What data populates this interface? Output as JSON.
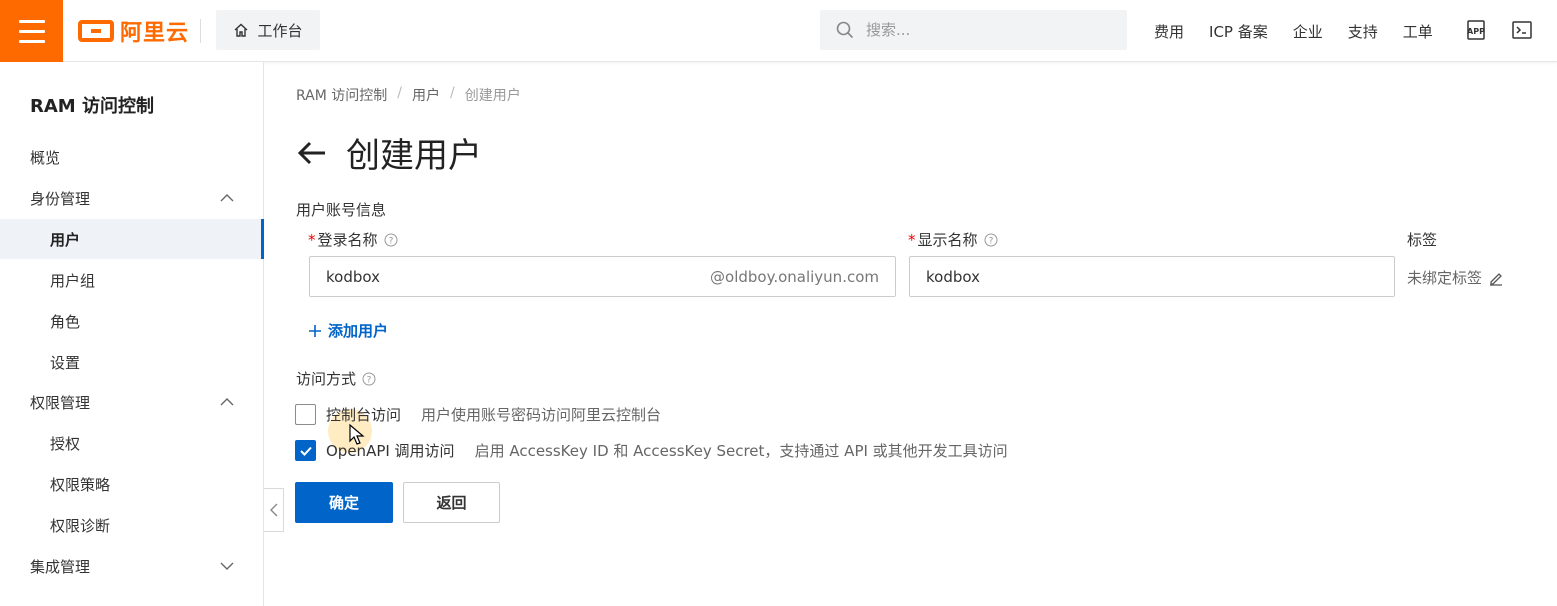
{
  "topbar": {
    "brand": "阿里云",
    "workbench_label": "工作台",
    "search_placeholder": "搜索...",
    "nav": [
      "费用",
      "ICP 备案",
      "企业",
      "支持",
      "工单"
    ],
    "icons": [
      "app-icon",
      "terminal-icon"
    ]
  },
  "sidebar": {
    "title": "RAM 访问控制",
    "items": [
      {
        "label": "概览",
        "level": "group"
      },
      {
        "label": "身份管理",
        "level": "group",
        "expanded": true
      },
      {
        "label": "用户",
        "level": "sub",
        "active": true
      },
      {
        "label": "用户组",
        "level": "sub"
      },
      {
        "label": "角色",
        "level": "sub"
      },
      {
        "label": "设置",
        "level": "sub"
      },
      {
        "label": "权限管理",
        "level": "group",
        "expanded": true
      },
      {
        "label": "授权",
        "level": "sub"
      },
      {
        "label": "权限策略",
        "level": "sub"
      },
      {
        "label": "权限诊断",
        "level": "sub"
      },
      {
        "label": "集成管理",
        "level": "group",
        "expanded": false
      }
    ]
  },
  "breadcrumb": [
    "RAM 访问控制",
    "用户",
    "创建用户"
  ],
  "page": {
    "title": "创建用户",
    "section_label": "用户账号信息",
    "login_name": {
      "label": "登录名称",
      "value": "kodbox",
      "suffix": "@oldboy.onaliyun.com"
    },
    "display_name": {
      "label": "显示名称",
      "value": "kodbox"
    },
    "tag": {
      "label": "标签",
      "value": "未绑定标签"
    },
    "add_user": "添加用户",
    "access": {
      "label": "访问方式",
      "options": [
        {
          "label": "控制台访问",
          "desc": "用户使用账号密码访问阿里云控制台",
          "checked": false
        },
        {
          "label": "OpenAPI 调用访问",
          "desc": "启用 AccessKey ID 和 AccessKey Secret，支持通过 API 或其他开发工具访问",
          "checked": true
        }
      ]
    },
    "confirm": "确定",
    "back": "返回"
  },
  "colors": {
    "brand": "#ff6a00",
    "primary": "#0064c8"
  }
}
